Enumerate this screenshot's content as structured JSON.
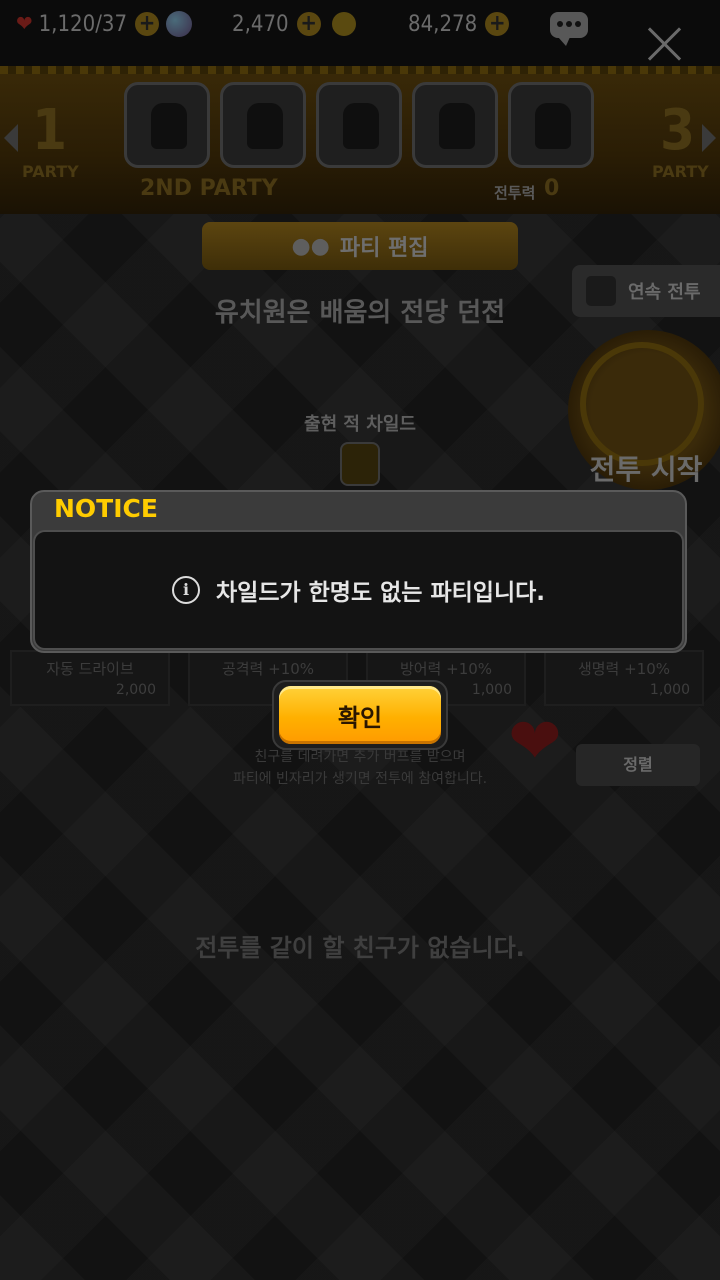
{
  "resources": {
    "stamina": "1,120/37",
    "gems": "2,470",
    "gold": "84,278"
  },
  "party": {
    "left_number": "1",
    "left_label": "PARTY",
    "right_number": "3",
    "right_label": "PARTY",
    "current_label": "2ND PARTY",
    "power_label": "전투력",
    "power_value": "0",
    "edit_label": "파티 편집"
  },
  "stage": {
    "dungeon_name": "유치원은 배움의 전당 던전",
    "enemy_label": "출현 적 차일드",
    "continuous_battle_label": "연속 전투",
    "battle_start_label": "전투 시작"
  },
  "buffs": [
    {
      "name": "자동 드라이브",
      "cost": "2,000"
    },
    {
      "name": "공격력 +10%",
      "cost": ""
    },
    {
      "name": "방어력 +10%",
      "cost": "1,000"
    },
    {
      "name": "생명력 +10%",
      "cost": "1,000"
    }
  ],
  "friends": {
    "note_line1": "친구를 데려가면 추가 버프를 받으며",
    "note_line2": "파티에 빈자리가 생기면 전투에 참여합니다.",
    "sort_label": "정렬",
    "empty_text": "전투를 같이 할 친구가 없습니다."
  },
  "dialog": {
    "title": "NOTICE",
    "message": "차일드가 한명도 없는 파티입니다.",
    "confirm_label": "확인"
  },
  "colors": {
    "notice_title": "#ffcc00",
    "confirm_button": "#ffb000"
  }
}
